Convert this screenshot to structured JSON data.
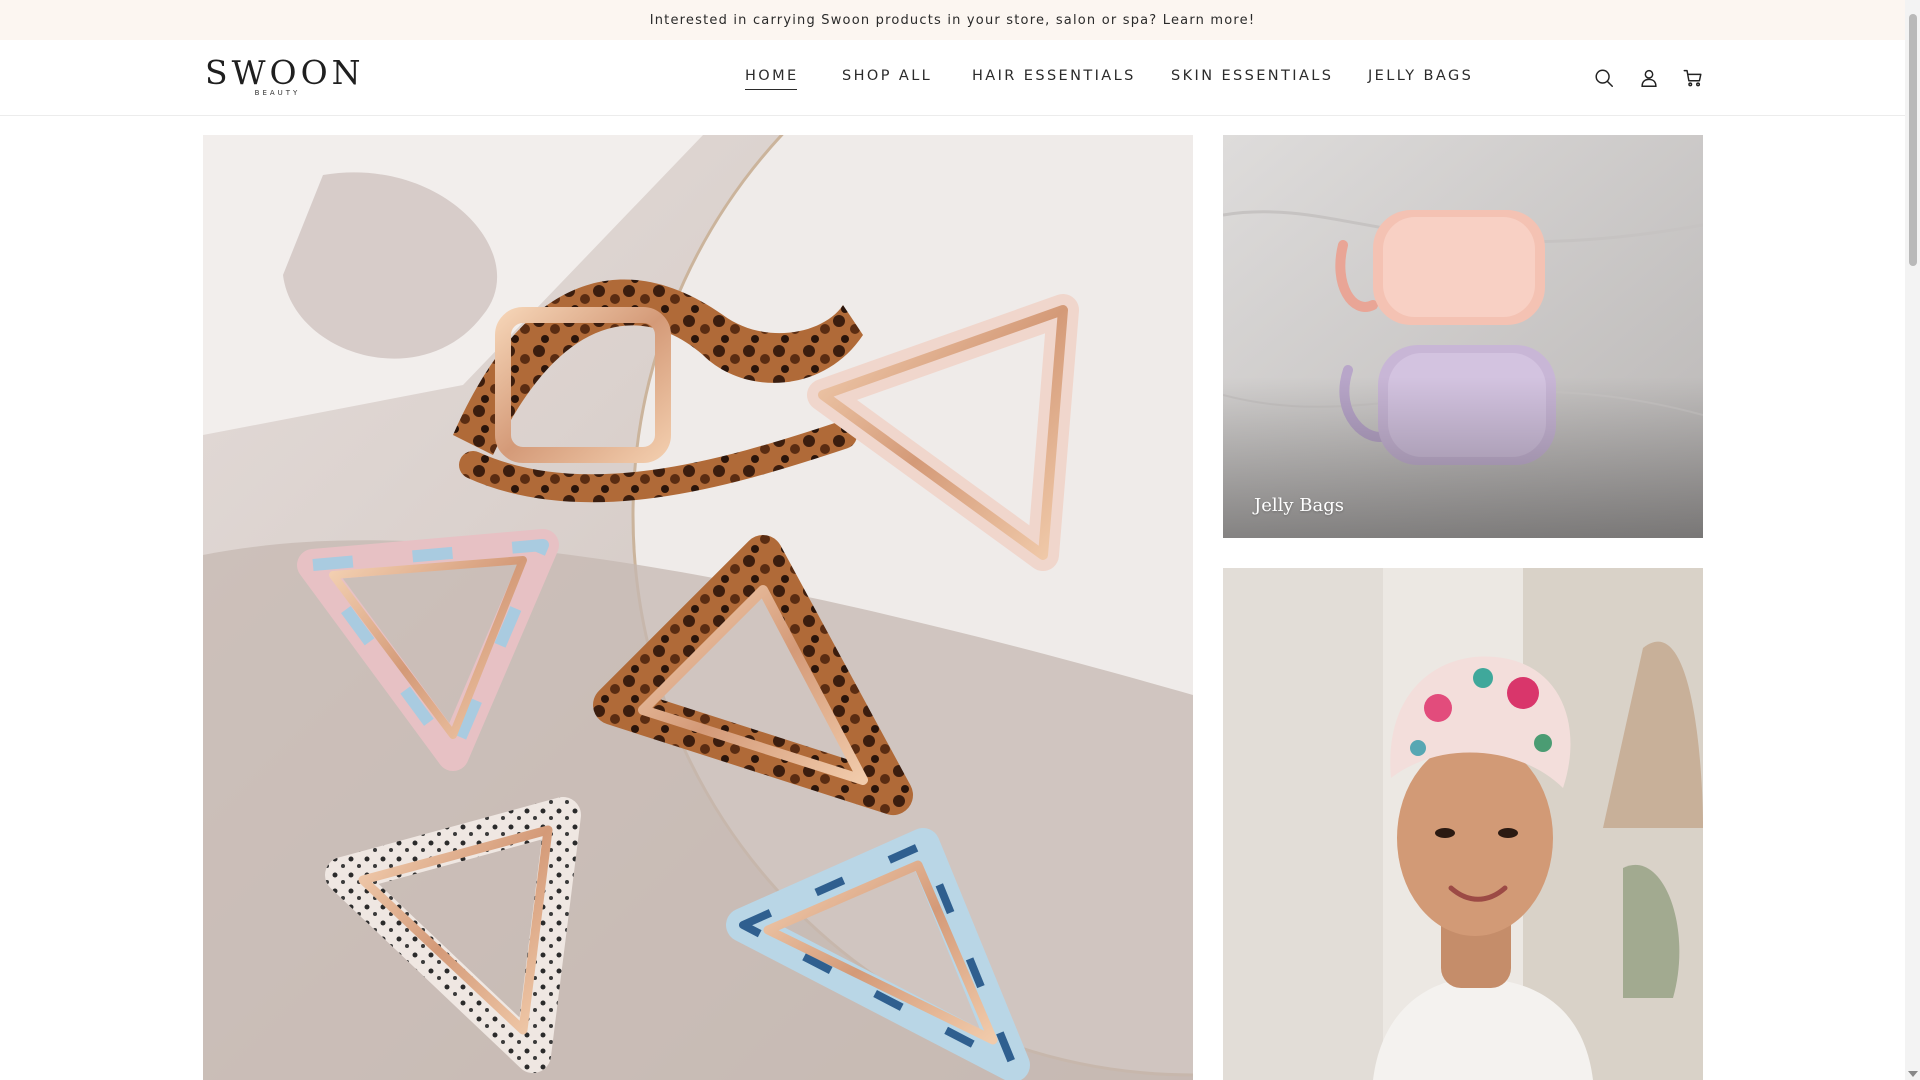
{
  "announcement": {
    "text": "Interested in carrying Swoon products in your store, salon or spa? Learn more!"
  },
  "brand": {
    "name": "SWOON",
    "tagline": "BEAUTY"
  },
  "nav": {
    "items": [
      {
        "label": "HOME",
        "active": true
      },
      {
        "label": "SHOP ALL",
        "active": false
      },
      {
        "label": "HAIR ESSENTIALS",
        "active": false
      },
      {
        "label": "SKIN ESSENTIALS",
        "active": false
      },
      {
        "label": "JELLY BAGS",
        "active": false
      }
    ]
  },
  "header_icons": [
    "search-icon",
    "account-icon",
    "cart-icon"
  ],
  "tiles": {
    "jelly_label": "Jelly Bags",
    "turban_label": ""
  },
  "colors": {
    "announcement_bg": "#fcf6f1",
    "text": "#1f1f1f",
    "jelly_pink": "#f4c2b3",
    "jelly_lilac": "#c8b6d6"
  }
}
